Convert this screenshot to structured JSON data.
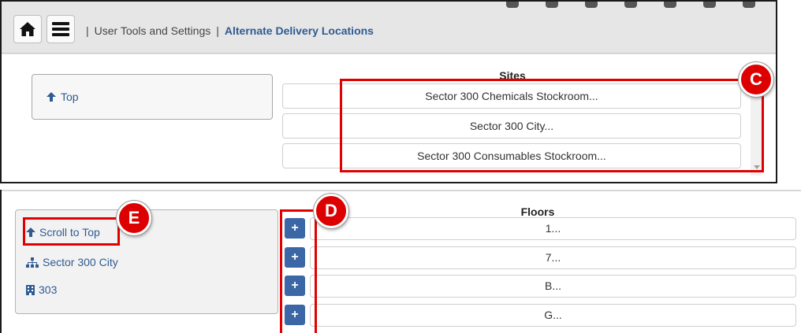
{
  "header": {
    "home_icon": "home-icon",
    "menu_icon": "hamburger-menu-icon",
    "separator": "|",
    "breadcrumb_parent": "User Tools and Settings",
    "breadcrumb_current": "Alternate Delivery Locations"
  },
  "sites_panel": {
    "top_link": "Top",
    "title": "Sites",
    "items": [
      "Sector 300 Chemicals Stockroom...",
      "Sector 300 City...",
      "Sector 300 Consumables Stockroom..."
    ]
  },
  "floors_panel": {
    "nav": {
      "scroll_to_top": "Scroll to Top",
      "site": "Sector 300 City",
      "building": "303"
    },
    "title": "Floors",
    "add_label": "+",
    "items": [
      "1...",
      "7...",
      "B...",
      "G..."
    ]
  },
  "annotations": {
    "c": "C",
    "d": "D",
    "e": "E"
  },
  "colors": {
    "accent": "#2f5b93",
    "button_blue": "#3b67a6",
    "annotation_red": "#e00000"
  }
}
